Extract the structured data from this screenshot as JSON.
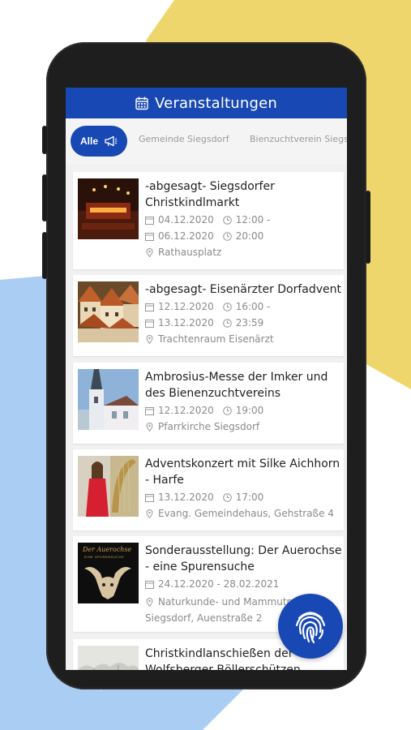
{
  "header": {
    "title": "Veranstaltungen",
    "icon": "calendar-icon"
  },
  "tabs": {
    "active_label": "Alle",
    "active_icon": "megaphone-icon",
    "items": [
      "Gemeinde Siegsdorf",
      "Bienzuchtverein Siegsdorf"
    ]
  },
  "events": [
    {
      "title": "-abgesagt- Siegsdorfer Christkindlmarkt",
      "date_start": "04.12.2020",
      "time_start": "12:00 -",
      "date_end": "06.12.2020",
      "time_end": "20:00",
      "location": "Rathausplatz"
    },
    {
      "title": "-abgesagt- Eisenärzter Dorfadvent",
      "date_start": "12.12.2020",
      "time_start": "16:00 -",
      "date_end": "13.12.2020",
      "time_end": "23:59",
      "location": "Trachtenraum Eisenärzt"
    },
    {
      "title": "Ambrosius-Messe der Imker und des Bienenzuchtvereins",
      "date": "12.12.2020",
      "time": "19:00",
      "location": "Pfarrkirche Siegsdorf"
    },
    {
      "title": "Adventskonzert mit Silke Aichhorn - Harfe",
      "date": "13.12.2020",
      "time": "17:00",
      "location": "Evang. Gemeindehaus, Gehstraße 4"
    },
    {
      "title": "Sonderausstellung: Der Auerochse - eine Spurensuche",
      "date": "24.12.2020 - 28.02.2021",
      "location": "Naturkunde- und Mammutm",
      "location_line2": "Siegsdorf, Auenstraße 2",
      "thumb_text_1": "Der Auerochse",
      "thumb_text_2": "EINE SPURENSUCHE"
    },
    {
      "title": "Christkindlanschießen der Wolfsberger Böllerschützen"
    }
  ],
  "colors": {
    "primary": "#1848b4",
    "yellow_bg": "#efd66c",
    "blue_bg": "#a9cdf3"
  },
  "fab_icon": "fingerprint-icon"
}
